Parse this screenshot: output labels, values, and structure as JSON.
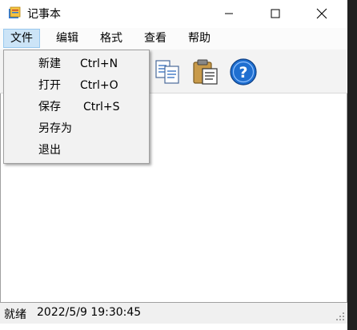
{
  "window": {
    "title": "记事本",
    "icon": "notepad-app-icon"
  },
  "menubar": {
    "items": [
      {
        "label": "文件",
        "active": true
      },
      {
        "label": "编辑"
      },
      {
        "label": "格式"
      },
      {
        "label": "查看"
      },
      {
        "label": "帮助"
      }
    ]
  },
  "file_menu": {
    "items": [
      {
        "label": "新建",
        "shortcut": "Ctrl+N"
      },
      {
        "label": "打开",
        "shortcut": "Ctrl+O"
      },
      {
        "label": "保存",
        "shortcut": "Ctrl+S"
      },
      {
        "label": "另存为",
        "shortcut": ""
      },
      {
        "label": "退出",
        "shortcut": ""
      }
    ]
  },
  "toolbar": {
    "icons": [
      "copy-icon",
      "paste-icon",
      "help-icon"
    ]
  },
  "status": {
    "ready": "就绪",
    "datetime": "2022/5/9 19:30:45"
  },
  "colors": {
    "menu_active_bg": "#cce4f7",
    "help_blue": "#1f6fd0"
  }
}
